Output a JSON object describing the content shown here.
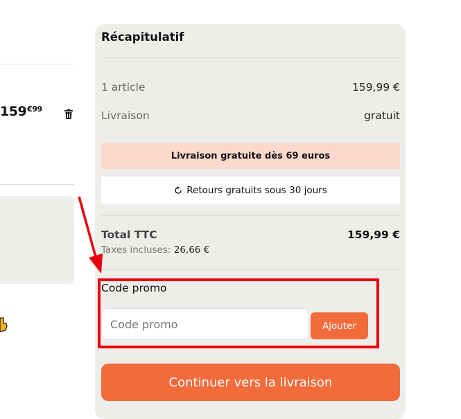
{
  "cart": {
    "item_price_main": "159",
    "item_price_cents": "€99"
  },
  "summary": {
    "title": "Récapitulatif",
    "articles_label": "1 article",
    "articles_value": "159,99 €",
    "shipping_label": "Livraison",
    "shipping_value": "gratuit",
    "free_shipping_banner": "Livraison gratuite dès 69 euros",
    "returns_banner": "Retours gratuits sous 30 jours",
    "total_label": "Total TTC",
    "total_value": "159,99 €",
    "taxes_label": "Taxes incluses:",
    "taxes_value": "26,66 €",
    "promo_label": "Code promo",
    "promo_placeholder": "Code promo",
    "promo_value": "",
    "add_label": "Ajouter",
    "continue_label": "Continuer vers la livraison"
  },
  "colors": {
    "accent": "#f26b3a",
    "panel_bg": "#efedea",
    "banner_bg": "#fdd9cd",
    "annotation": "#e8000b"
  },
  "icons": [
    "trash-icon",
    "pointing-hand-icon",
    "refresh-icon",
    "annotation-arrow"
  ]
}
